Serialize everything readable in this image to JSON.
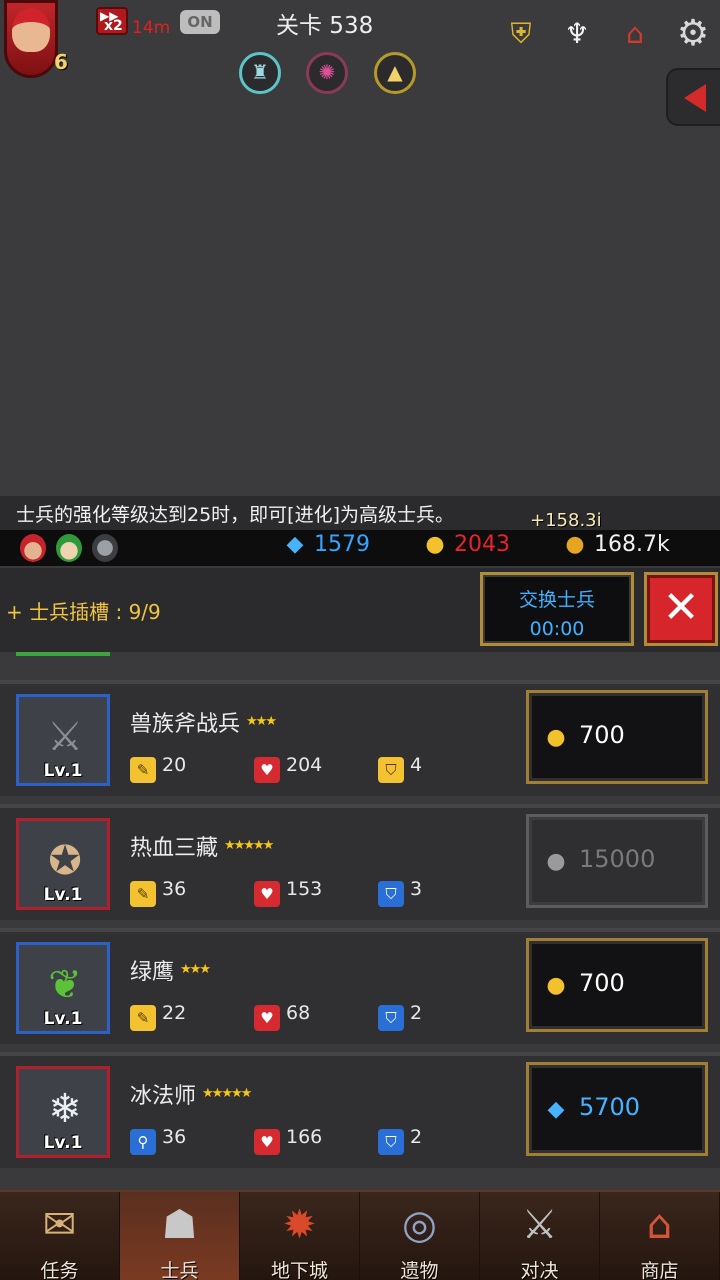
{
  "hud": {
    "player_level": "6",
    "speed_label": "x2",
    "speed_timer": "14m",
    "auto_toggle": "ON",
    "stage": "关卡 538"
  },
  "tip": "士兵的强化等级达到25时，即可[进化]为高级士兵。",
  "floating_gain": "+158.3i",
  "currency": {
    "gems": "1579",
    "medals": "2043",
    "gold": "168.7k"
  },
  "slot": {
    "label": "+ 士兵插槽 : 9/9",
    "swap_label": "交换士兵",
    "swap_timer": "00:00",
    "close_label": "✕",
    "peek_level": "Lv.1"
  },
  "soldiers": [
    {
      "name": "兽族斧战兵",
      "stars": "★★★",
      "level": "Lv.1",
      "frame": "blue",
      "atk": "20",
      "hp": "204",
      "def": "4",
      "cost": "700",
      "currency": "medal",
      "available": true
    },
    {
      "name": "热血三藏",
      "stars": "★★★★★",
      "level": "Lv.1",
      "frame": "red",
      "atk": "36",
      "hp": "153",
      "def": "3",
      "cost": "15000",
      "currency": "medal",
      "available": false
    },
    {
      "name": "绿鹰",
      "stars": "★★★",
      "level": "Lv.1",
      "frame": "blue",
      "atk": "22",
      "hp": "68",
      "def": "2",
      "cost": "700",
      "currency": "medal",
      "available": true
    },
    {
      "name": "冰法师",
      "stars": "★★★★★",
      "level": "Lv.1",
      "frame": "red",
      "atk": "36",
      "hp": "166",
      "def": "2",
      "cost": "5700",
      "currency": "gem",
      "available": true
    }
  ],
  "nav": [
    {
      "label": "任务",
      "icon": "scroll-icon",
      "active": false
    },
    {
      "label": "士兵",
      "icon": "helmet-icon",
      "active": true
    },
    {
      "label": "地下城",
      "icon": "monster-icon",
      "active": false
    },
    {
      "label": "遗物",
      "icon": "relic-icon",
      "active": false
    },
    {
      "label": "对决",
      "icon": "crossed-swords-icon",
      "active": false
    },
    {
      "label": "商店",
      "icon": "shop-icon",
      "active": false
    }
  ],
  "colors": {
    "gem": "#36a4ff",
    "medal": "#e8232a",
    "accent_gold": "#f2c440",
    "close_red": "#d6262c"
  }
}
